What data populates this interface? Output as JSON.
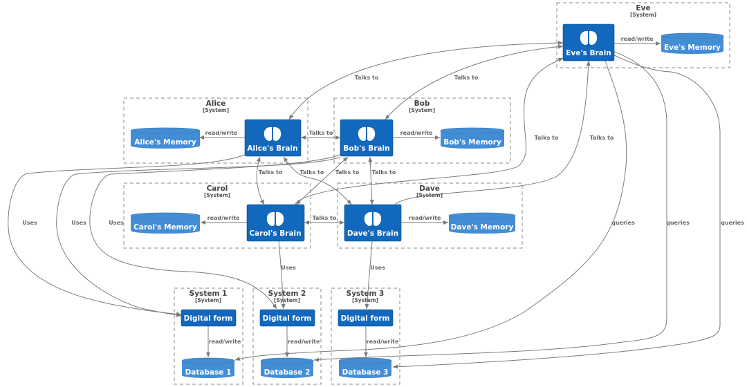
{
  "diagram": {
    "colors": {
      "component": "#1168bd",
      "database": "#438dd5",
      "edge": "#7a7a7a",
      "boundary": "#8a8a8a"
    },
    "systems": [
      {
        "id": "eve",
        "title": "Eve",
        "type": "[System]"
      },
      {
        "id": "alice",
        "title": "Alice",
        "type": "[System]"
      },
      {
        "id": "bob",
        "title": "Bob",
        "type": "[System]"
      },
      {
        "id": "carol",
        "title": "Carol",
        "type": "[System]"
      },
      {
        "id": "dave",
        "title": "Dave",
        "type": "[System]"
      },
      {
        "id": "sys1",
        "title": "System 1",
        "type": "[System]"
      },
      {
        "id": "sys2",
        "title": "System 2",
        "type": "[System]"
      },
      {
        "id": "sys3",
        "title": "System 3",
        "type": "[System]"
      }
    ],
    "components": [
      {
        "id": "eve_brain",
        "label": "Eve's Brain",
        "icon": "brain-icon"
      },
      {
        "id": "alice_brain",
        "label": "Alice's Brain",
        "icon": "brain-icon"
      },
      {
        "id": "bob_brain",
        "label": "Bob's Brain",
        "icon": "brain-icon"
      },
      {
        "id": "carol_brain",
        "label": "Carol's Brain",
        "icon": "brain-icon"
      },
      {
        "id": "dave_brain",
        "label": "Dave's Brain",
        "icon": "brain-icon"
      },
      {
        "id": "form1",
        "label": "Digital form"
      },
      {
        "id": "form2",
        "label": "Digital form"
      },
      {
        "id": "form3",
        "label": "Digital form"
      }
    ],
    "databases": [
      {
        "id": "eve_mem",
        "label": "Eve's Memory"
      },
      {
        "id": "alice_mem",
        "label": "Alice's Memory"
      },
      {
        "id": "bob_mem",
        "label": "Bob's Memory"
      },
      {
        "id": "carol_mem",
        "label": "Carol's Memory"
      },
      {
        "id": "dave_mem",
        "label": "Dave's Memory"
      },
      {
        "id": "db1",
        "label": "Database 1"
      },
      {
        "id": "db2",
        "label": "Database 2"
      },
      {
        "id": "db3",
        "label": "Database 3"
      }
    ],
    "edges": [
      {
        "from": "eve_brain",
        "to": "eve_mem",
        "label": "read/write"
      },
      {
        "from": "alice_brain",
        "to": "alice_mem",
        "label": "read/write"
      },
      {
        "from": "bob_brain",
        "to": "bob_mem",
        "label": "read/write"
      },
      {
        "from": "carol_brain",
        "to": "carol_mem",
        "label": "read/write"
      },
      {
        "from": "dave_brain",
        "to": "dave_mem",
        "label": "read/write"
      },
      {
        "from": "eve_brain",
        "to": "alice_brain",
        "label": "Talks to"
      },
      {
        "from": "eve_brain",
        "to": "bob_brain",
        "label": "Talks to"
      },
      {
        "from": "carol_brain",
        "to": "eve_brain",
        "label": "Talks to"
      },
      {
        "from": "dave_brain",
        "to": "eve_brain",
        "label": "Talks to"
      },
      {
        "from": "alice_brain",
        "to": "bob_brain",
        "label": "Talks to"
      },
      {
        "from": "alice_brain",
        "to": "carol_brain",
        "label": "Talks to"
      },
      {
        "from": "alice_brain",
        "to": "dave_brain",
        "label": "Talks to"
      },
      {
        "from": "bob_brain",
        "to": "carol_brain",
        "label": "Talks to"
      },
      {
        "from": "bob_brain",
        "to": "dave_brain",
        "label": "Talks to"
      },
      {
        "from": "carol_brain",
        "to": "dave_brain",
        "label": "Talks to"
      },
      {
        "from": "alice_brain",
        "to": "form1",
        "label": "Uses"
      },
      {
        "from": "bob_brain",
        "to": "form1",
        "label": "Uses"
      },
      {
        "from": "carol_brain",
        "to": "form2",
        "label": "Uses"
      },
      {
        "from": "bob_brain",
        "to": "form2",
        "label": "Uses"
      },
      {
        "from": "dave_brain",
        "to": "form3",
        "label": "Uses"
      },
      {
        "from": "form1",
        "to": "db1",
        "label": "read/write"
      },
      {
        "from": "form2",
        "to": "db2",
        "label": "read/write"
      },
      {
        "from": "form3",
        "to": "db3",
        "label": "read/write"
      },
      {
        "from": "eve_brain",
        "to": "db1",
        "label": "queries"
      },
      {
        "from": "eve_brain",
        "to": "db2",
        "label": "queries"
      },
      {
        "from": "eve_brain",
        "to": "db3",
        "label": "queries"
      }
    ]
  }
}
